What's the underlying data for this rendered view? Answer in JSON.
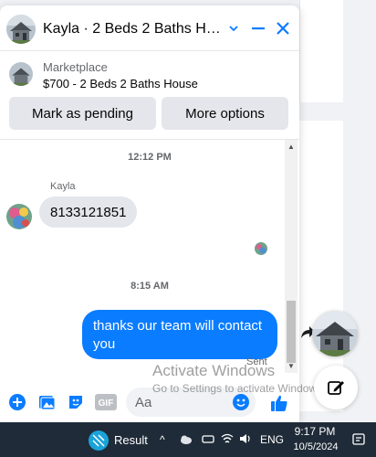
{
  "chat": {
    "title": "Kayla · 2 Beds 2 Baths Hou...",
    "marketplace_label": "Marketplace",
    "listing_title": "$700 - 2 Beds 2 Baths House",
    "actions": {
      "mark_pending": "Mark as pending",
      "more_options": "More options"
    },
    "messages": {
      "timestamp_1": "12:12 PM",
      "sender_name": "Kayla",
      "incoming_text": "8133121851",
      "timestamp_2": "8:15 AM",
      "outgoing_text": "thanks our team will contact you",
      "status": "Sent"
    },
    "composer": {
      "placeholder": "Aa"
    },
    "colors": {
      "accent": "#0a7cff",
      "incoming_bubble": "#e4e6eb"
    }
  },
  "watermark": {
    "title": "Activate Windows",
    "subtitle": "Go to Settings to activate Windows."
  },
  "taskbar": {
    "app_label": "Result",
    "language": "ENG",
    "time": "9:17 PM",
    "date": "10/5/2024"
  }
}
